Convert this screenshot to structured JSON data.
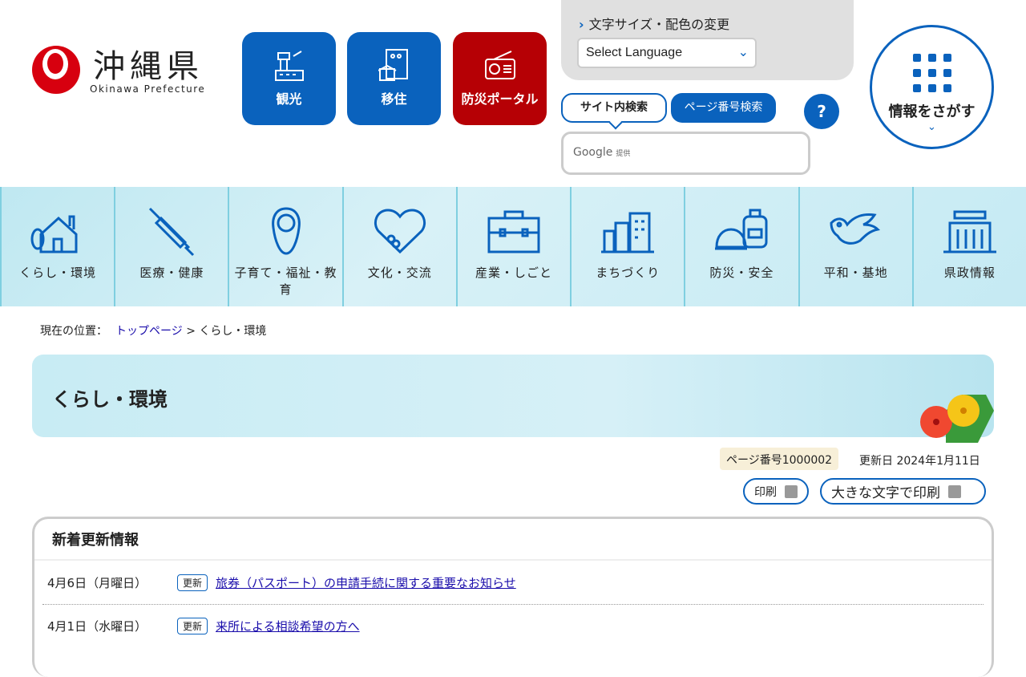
{
  "header": {
    "logo_jp": "沖縄県",
    "logo_en": "Okinawa Prefecture",
    "quick": [
      {
        "label": "観光"
      },
      {
        "label": "移住"
      },
      {
        "label": "防災ポータル"
      }
    ],
    "text_settings": "文字サイズ・配色の変更",
    "language_select": "Select Language",
    "search_tabs": [
      "サイト内検索",
      "ページ番号検索"
    ],
    "help": "?",
    "google_label": "Google",
    "google_provided": "提供",
    "find_info": "情報をさがす"
  },
  "nav": [
    "くらし・環境",
    "医療・健康",
    "子育て・福祉・教育",
    "文化・交流",
    "産業・しごと",
    "まちづくり",
    "防災・安全",
    "平和・基地",
    "県政情報"
  ],
  "breadcrumb": {
    "label": "現在の位置：",
    "home": "トップページ",
    "sep": ">",
    "current": "くらし・環境"
  },
  "page": {
    "title": "くらし・環境",
    "page_number": "ページ番号1000002",
    "updated": "更新日 2024年1月11日",
    "print": "印刷",
    "print_large": "大きな文字で印刷"
  },
  "news": {
    "title": "新着更新情報",
    "items": [
      {
        "date": "4月6日（月曜日）",
        "badge": "更新",
        "text": "旅券（パスポート）の申請手続に関する重要なお知らせ"
      },
      {
        "date": "4月1日（水曜日）",
        "badge": "更新",
        "text": "来所による相談希望の方へ"
      }
    ]
  },
  "colors": {
    "primary": "#0a62bd",
    "disaster": "#b60005",
    "logo": "#d7000f"
  }
}
